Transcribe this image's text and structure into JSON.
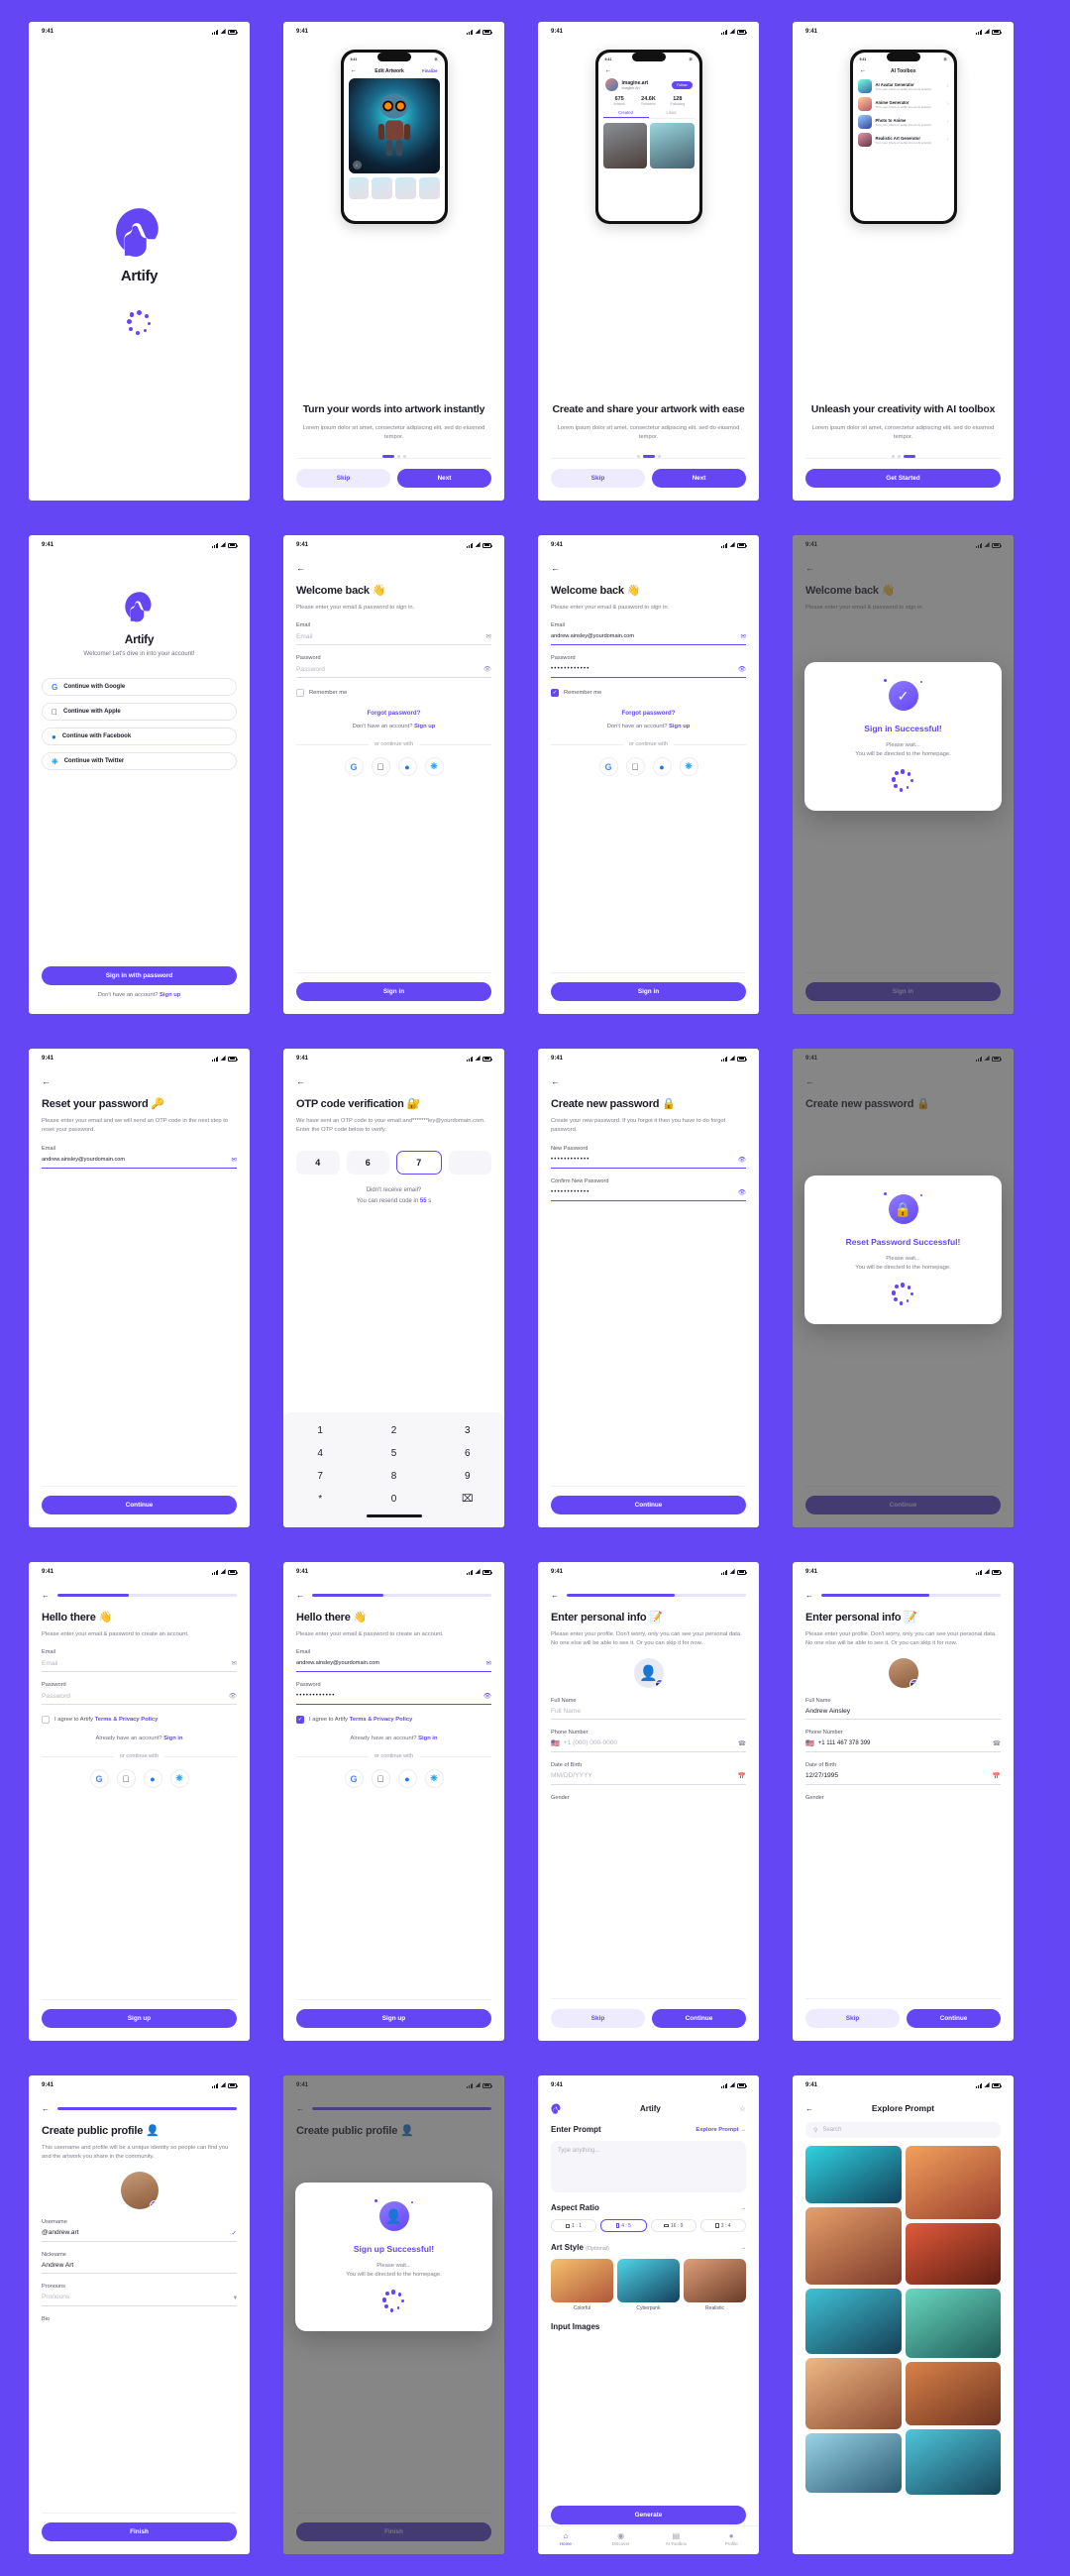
{
  "brand": {
    "name": "Artify",
    "accent": "#6446F5",
    "background": "#6446F5"
  },
  "status_bar": {
    "time": "9:41",
    "wifi_icon": "wifi-icon",
    "signal_icon": "signal-icon",
    "battery_icon": "battery-icon"
  },
  "screens": {
    "splash": {
      "app_name": "Artify"
    },
    "onboarding": [
      {
        "title": "Turn your words into artwork instantly",
        "description": "Lorem ipsum dolor sit amet, consectetur adipiscing elit, sed do eiusmod tempor.",
        "skip_label": "Skip",
        "next_label": "Next",
        "active_dot": 0,
        "mock": {
          "nav_title": "Edit Artwork",
          "nav_action": "Finalize",
          "time": "9:41"
        }
      },
      {
        "title": "Create and share your artwork with ease",
        "description": "Lorem ipsum dolor sit amet, consectetur adipiscing elit, sed do eiusmod tempor.",
        "skip_label": "Skip",
        "next_label": "Next",
        "active_dot": 1,
        "mock": {
          "time": "9:41",
          "username": "imagine.art",
          "display_name": "Imagine Art",
          "follow_label": "Follow",
          "stats": [
            {
              "value": "675",
              "label": "Artwork"
            },
            {
              "value": "24.6K",
              "label": "Followers"
            },
            {
              "value": "128",
              "label": "Following"
            }
          ],
          "tabs": [
            "Created",
            "Liked"
          ]
        }
      },
      {
        "title": "Unleash your creativity with AI toolbox",
        "description": "Lorem ipsum dolor sit amet, consectetur adipiscing elit, sed do eiusmod tempor.",
        "cta_label": "Get Started",
        "active_dot": 2,
        "mock": {
          "time": "9:41",
          "nav_title": "AI Toolbox",
          "items": [
            {
              "title": "AI Avatar Generator",
              "desc": "Turn your photo or selfie into an Al artwork"
            },
            {
              "title": "Anime Generator",
              "desc": "Turn your photo or selfie into an Al artwork"
            },
            {
              "title": "Photo to Anime",
              "desc": "Turn your photo or selfie into an Al artwork"
            },
            {
              "title": "Realistic Art Generator",
              "desc": "Turn your photo or selfie into an Al artwork"
            }
          ]
        }
      }
    ],
    "welcome_social": {
      "app_name": "Artify",
      "subtitle": "Welcome! Let's dive in into your account!",
      "providers": [
        {
          "label": "Continue with Google",
          "icon": "google-icon"
        },
        {
          "label": "Continue with Apple",
          "icon": "apple-icon"
        },
        {
          "label": "Continue with Facebook",
          "icon": "facebook-icon"
        },
        {
          "label": "Continue with Twitter",
          "icon": "twitter-icon"
        }
      ],
      "primary_label": "Sign in with password",
      "footer_text": "Don't have an account?",
      "footer_link": "Sign up"
    },
    "sign_in_empty": {
      "title": "Welcome back 👋",
      "lead": "Please enter your email & password to sign in.",
      "email_label": "Email",
      "email_placeholder": "Email",
      "email_value": "",
      "password_label": "Password",
      "password_placeholder": "Password",
      "password_value": "",
      "remember_label": "Remember me",
      "remember_checked": false,
      "forgot_label": "Forgot password?",
      "no_account_text": "Don't have an account?",
      "sign_up_link": "Sign up",
      "or_text": "or continue with",
      "submit_label": "Sign in"
    },
    "sign_in_filled": {
      "title": "Welcome back 👋",
      "lead": "Please enter your email & password to sign in.",
      "email_label": "Email",
      "email_value": "andrew.ainsley@yourdomain.com",
      "password_label": "Password",
      "password_value": "••••••••••••",
      "remember_label": "Remember me",
      "remember_checked": true,
      "forgot_label": "Forgot password?",
      "no_account_text": "Don't have an account?",
      "sign_up_link": "Sign up",
      "or_text": "or continue with",
      "submit_label": "Sign in"
    },
    "sign_in_success": {
      "bg_title": "Welcome back 👋",
      "bg_lead": "Please enter your email & password to sign in.",
      "bg_submit": "Sign in",
      "modal_title": "Sign in Successful!",
      "modal_sub": "Please wait...\nYou will be directed to the homepage.",
      "icon": "check-circle-icon"
    },
    "reset_password": {
      "title": "Reset your password 🔑",
      "lead": "Please enter your email and we will send an OTP code in the next step to reset your password.",
      "email_label": "Email",
      "email_value": "andrew.ainsley@yourdomain.com",
      "submit_label": "Continue"
    },
    "otp": {
      "title": "OTP code verification 🔐",
      "lead": "We have sent an OTP code to your email and*******ley@yourdomain.com. Enter the OTP code below to verify.",
      "digits": [
        "4",
        "6",
        "7",
        ""
      ],
      "selected_index": 2,
      "didnt_receive": "Didn't receive email?",
      "resend_prefix": "You can resend code in ",
      "resend_seconds": "55",
      "resend_suffix": " s",
      "keypad": [
        "1",
        "2",
        "3",
        "4",
        "5",
        "6",
        "7",
        "8",
        "9",
        "*",
        "0",
        "⌧"
      ]
    },
    "create_password": {
      "title": "Create new password 🔒",
      "lead": "Create your new password. If you forgot it then you have to do forgot password.",
      "new_label": "New Password",
      "new_value": "••••••••••••",
      "confirm_label": "Confirm New Password",
      "confirm_value": "••••••••••••",
      "submit_label": "Continue"
    },
    "reset_success": {
      "bg_title": "Create new password 🔒",
      "bg_submit": "Continue",
      "modal_title": "Reset Password Successful!",
      "modal_sub": "Please wait...\nYou will be directed to the homepage.",
      "icon": "lock-icon"
    },
    "sign_up_empty": {
      "title": "Hello there 👋",
      "lead": "Please enter your email & password to create an account.",
      "email_label": "Email",
      "email_placeholder": "Email",
      "password_label": "Password",
      "password_placeholder": "Password",
      "agree_prefix": "I agree to Artify ",
      "agree_link": "Terms & Privacy Policy",
      "agree_checked": false,
      "have_account": "Already have an account?",
      "sign_in_link": "Sign in",
      "or_text": "or continue with",
      "submit_label": "Sign up",
      "progress": 40
    },
    "sign_up_filled": {
      "title": "Hello there 👋",
      "lead": "Please enter your email & password to create an account.",
      "email_label": "Email",
      "email_value": "andrew.ainsley@yourdomain.com",
      "password_label": "Password",
      "password_value": "••••••••••••",
      "agree_prefix": "I agree to Artify ",
      "agree_link": "Terms & Privacy Policy",
      "agree_checked": true,
      "have_account": "Already have an account?",
      "sign_in_link": "Sign in",
      "or_text": "or continue with",
      "submit_label": "Sign up",
      "progress": 40
    },
    "personal_empty": {
      "title": "Enter personal info 📝",
      "lead": "Please enter your profile. Don't worry, only you can see your personal data. No one else will be able to see it. Or you can skip it for now.",
      "full_name_label": "Full Name",
      "full_name_placeholder": "Full Name",
      "phone_label": "Phone Number",
      "phone_placeholder": "+1 (000) 000-0000",
      "phone_flag": "🇺🇸",
      "dob_label": "Date of Birth",
      "dob_placeholder": "MM/DD/YYYY",
      "gender_label": "Gender",
      "skip_label": "Skip",
      "continue_label": "Continue",
      "progress": 60
    },
    "personal_filled": {
      "title": "Enter personal info 📝",
      "lead": "Please enter your profile. Don't worry, only you can see your personal data. No one else will be able to see it. Or you can skip it for now.",
      "full_name_label": "Full Name",
      "full_name_value": "Andrew Ainsley",
      "phone_label": "Phone Number",
      "phone_value": "+1 111 467 378 399",
      "phone_flag": "🇺🇸",
      "dob_label": "Date of Birth",
      "dob_value": "12/27/1995",
      "gender_label": "Gender",
      "skip_label": "Skip",
      "continue_label": "Continue",
      "progress": 60
    },
    "public_profile": {
      "title": "Create public profile 👤",
      "lead": "This username and profile will be a unique identity so people can find you and the artwork you share in the community.",
      "username_label": "Username",
      "username_value": "@andrew.art",
      "nickname_label": "Nickname",
      "nickname_value": "Andrew Art",
      "pronouns_label": "Pronouns",
      "pronouns_placeholder": "Pronouns",
      "bio_label": "Bio",
      "submit_label": "Finish",
      "progress": 100
    },
    "sign_up_success": {
      "bg_title": "Create public profile 👤",
      "bg_submit": "Finish",
      "modal_title": "Sign up Successful!",
      "modal_sub": "Please wait...\nYou will be directed to the homepage.",
      "icon": "user-circle-icon"
    },
    "enter_prompt": {
      "app_title": "Artify",
      "section_title": "Enter Prompt",
      "explore_link": "Explore Prompt",
      "textarea_placeholder": "Type anything...",
      "aspect_label": "Aspect Ratio",
      "aspect_options": [
        "1 : 1",
        "4 : 5",
        "16 : 9",
        "3 : 4"
      ],
      "aspect_selected": 1,
      "style_label": "Art Style",
      "style_optional": "(Optional)",
      "styles": [
        "Colorful",
        "Cyberpunk",
        "Realistic"
      ],
      "input_images_label": "Input Images",
      "generate_label": "Generate",
      "tabs": [
        {
          "label": "Home",
          "icon": "home-icon"
        },
        {
          "label": "Discover",
          "icon": "compass-icon"
        },
        {
          "label": "AI Toolbox",
          "icon": "toolbox-icon"
        },
        {
          "label": "Profile",
          "icon": "person-icon"
        }
      ],
      "active_tab": 0
    },
    "explore_prompt": {
      "title": "Explore Prompt",
      "search_placeholder": "Search",
      "search_icon": "search-icon"
    }
  }
}
